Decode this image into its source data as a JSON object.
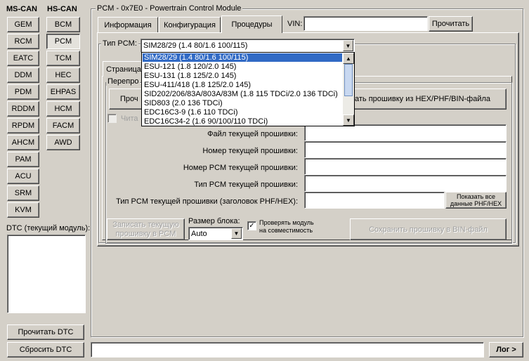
{
  "left_panel": {
    "ms_can_header": "MS-CAN",
    "hs_can_header": "HS-CAN",
    "ms_can_modules": [
      "GEM",
      "RCM",
      "EATC",
      "DDM",
      "PDM",
      "RDDM",
      "RPDM",
      "AHCM",
      "PAM",
      "ACU",
      "SRM",
      "KVM"
    ],
    "hs_can_modules": [
      "BCM",
      "PCM",
      "TCM",
      "HEC",
      "EHPAS",
      "HCM",
      "FACM",
      "AWD"
    ],
    "dtc_label": "DTC (текущий модуль):",
    "read_dtc": "Прочитать DTC",
    "clear_dtc": "Сбросить DTC"
  },
  "module_group": {
    "title": "PCM - 0x7E0 - Powertrain Control Module",
    "tabs": [
      "Информация",
      "Конфигурация",
      "Процедуры"
    ],
    "vin_label": "VIN:",
    "vin_value": "",
    "read_button": "Прочитать"
  },
  "pcm_type": {
    "label": "Тип PCM:",
    "selected": "SIM28/29 (1.4 80/1.6 100/115)",
    "options": [
      "SIM28/29 (1.4 80/1.6 100/115)",
      "ESU-121 (1.8 120/2.0 145)",
      "ESU-131 (1.8 125/2.0 145)",
      "ESU-411/418 (1.8 125/2.0 145)",
      "SID202/206/83A/803A/83M (1.8 115 TDCi/2.0 136 TDCi)",
      "SID803 (2.0 136 TDCi)",
      "EDC16C3-9 (1.6 110 TDCi)",
      "EDC16C34-2 (1.6 90/100/110 TDCi)"
    ]
  },
  "inner": {
    "tab_partial": "Страница",
    "group_partial": "Перепро",
    "read_partial": "Проч",
    "write_hex": "ать прошивку из HEX/PHF/BIN-файла",
    "checkbox_partial": "Чита",
    "rows": [
      {
        "label": "Файл текущей прошивки:",
        "value": ""
      },
      {
        "label": "Номер текущей прошивки:",
        "value": ""
      },
      {
        "label": "Номер PCM текущей прошивки:",
        "value": ""
      },
      {
        "label": "Тип PCM текущей прошивки:",
        "value": ""
      },
      {
        "label": "Тип PCM текущей прошивки (заголовок PHF/HEX):",
        "value": ""
      }
    ],
    "show_all_line1": "Показать все",
    "show_all_line2": "данные PHF/HEX",
    "write_line1": "Записать текущую",
    "write_line2": "прошивку в PCM",
    "block_size_label": "Размер блока:",
    "block_size_value": "Auto",
    "check_compat_line1": "Проверять модуль",
    "check_compat_line2": "на совместимость",
    "save_bin": "Сохранить прошивку в BIN-файл"
  },
  "bottom": {
    "status_value": "",
    "log_button": "Лог >"
  }
}
